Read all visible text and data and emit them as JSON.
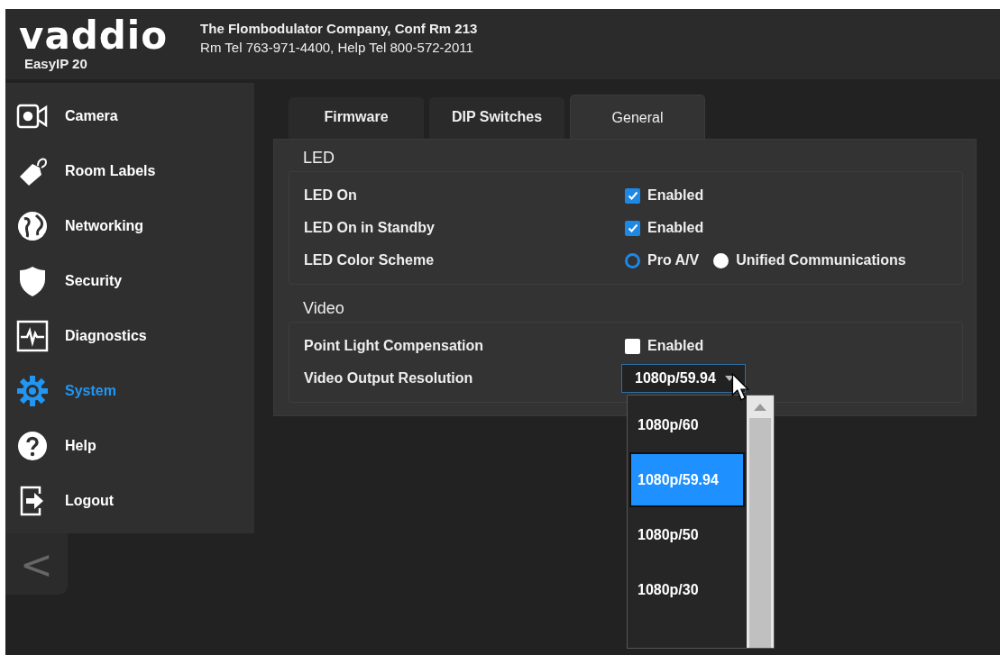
{
  "header": {
    "logo": "vaddio",
    "product": "EasyIP 20",
    "line1": "The Flombodulator Company, Conf Rm 213",
    "line2": "Rm Tel 763-971-4400, Help Tel 800-572-2011"
  },
  "sidebar": {
    "items": [
      {
        "label": "Camera",
        "selected": false
      },
      {
        "label": "Room Labels",
        "selected": false
      },
      {
        "label": "Networking",
        "selected": false
      },
      {
        "label": "Security",
        "selected": false
      },
      {
        "label": "Diagnostics",
        "selected": false
      },
      {
        "label": "System",
        "selected": true
      },
      {
        "label": "Help",
        "selected": false
      },
      {
        "label": "Logout",
        "selected": false
      }
    ],
    "collapse": "<"
  },
  "tabs": [
    {
      "label": "Firmware",
      "selected": false
    },
    {
      "label": "DIP Switches",
      "selected": false
    },
    {
      "label": "General",
      "selected": true
    }
  ],
  "sections": [
    {
      "title": "LED",
      "rows": [
        {
          "label": "LED On",
          "kind": "checkbox",
          "checked": true,
          "text": "Enabled"
        },
        {
          "label": "LED On in Standby",
          "kind": "checkbox",
          "checked": true,
          "text": "Enabled"
        },
        {
          "label": "LED Color Scheme",
          "kind": "radio",
          "options": [
            {
              "label": "Pro A/V",
              "selected": true
            },
            {
              "label": "Unified Communications",
              "selected": false
            }
          ]
        }
      ]
    },
    {
      "title": "Video",
      "rows": [
        {
          "label": "Point Light Compensation",
          "kind": "checkbox",
          "checked": false,
          "text": "Enabled"
        },
        {
          "label": "Video Output Resolution",
          "kind": "select",
          "value": "1080p/59.94",
          "expanded": true,
          "options": [
            {
              "label": "1080p/60",
              "selected": false
            },
            {
              "label": "1080p/59.94",
              "selected": true
            },
            {
              "label": "1080p/50",
              "selected": false
            },
            {
              "label": "1080p/30",
              "selected": false
            }
          ]
        }
      ]
    }
  ]
}
